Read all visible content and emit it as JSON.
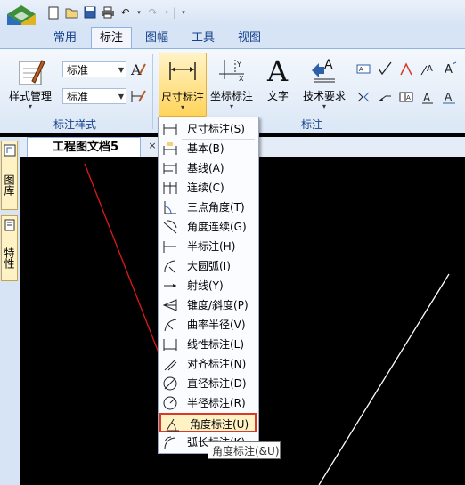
{
  "ribbon_tabs": [
    "常用",
    "标注",
    "图幅",
    "工具",
    "视图"
  ],
  "active_tab": "标注",
  "style_group": {
    "button_label": "样式管理",
    "combo1_value": "标准",
    "combo2_value": "标准",
    "group_label": "标注样式"
  },
  "annotation_group": {
    "dimension_label": "尺寸标注",
    "coord_label": "坐标标注",
    "text_label": "文字",
    "tech_label": "技术要求",
    "group_label": "标注"
  },
  "document": {
    "tab_title": "工程图文档5",
    "close_glyph": "×"
  },
  "side_panel": {
    "tab1_label": "图库",
    "tab2_label": "特性"
  },
  "dimension_menu": {
    "items": [
      {
        "label": "尺寸标注(S)",
        "icon": "dimension-icon"
      },
      {
        "label": "基本(B)",
        "icon": "basic-dim-icon"
      },
      {
        "label": "基线(A)",
        "icon": "baseline-dim-icon"
      },
      {
        "label": "连续(C)",
        "icon": "continuous-dim-icon"
      },
      {
        "label": "三点角度(T)",
        "icon": "three-point-angle-icon"
      },
      {
        "label": "角度连续(G)",
        "icon": "angle-continuous-icon"
      },
      {
        "label": "半标注(H)",
        "icon": "half-dim-icon"
      },
      {
        "label": "大圆弧(I)",
        "icon": "large-arc-icon"
      },
      {
        "label": "射线(Y)",
        "icon": "ray-icon"
      },
      {
        "label": "锥度/斜度(P)",
        "icon": "taper-slope-icon"
      },
      {
        "label": "曲率半径(V)",
        "icon": "curvature-radius-icon"
      },
      {
        "label": "线性标注(L)",
        "icon": "linear-dim-icon"
      },
      {
        "label": "对齐标注(N)",
        "icon": "aligned-dim-icon"
      },
      {
        "label": "直径标注(D)",
        "icon": "diameter-dim-icon"
      },
      {
        "label": "半径标注(R)",
        "icon": "radius-dim-icon"
      },
      {
        "label": "角度标注(U)",
        "icon": "angle-dim-icon"
      },
      {
        "label": "弧长标注(K)",
        "icon": "arc-length-icon"
      }
    ],
    "highlighted_index": 15
  },
  "tooltip": "角度标注(&U)",
  "colors": {
    "accent": "#15428b",
    "highlight": "#fff3c6",
    "highlight_border": "#d83a2a",
    "annotation_arrow": "#e01818"
  }
}
